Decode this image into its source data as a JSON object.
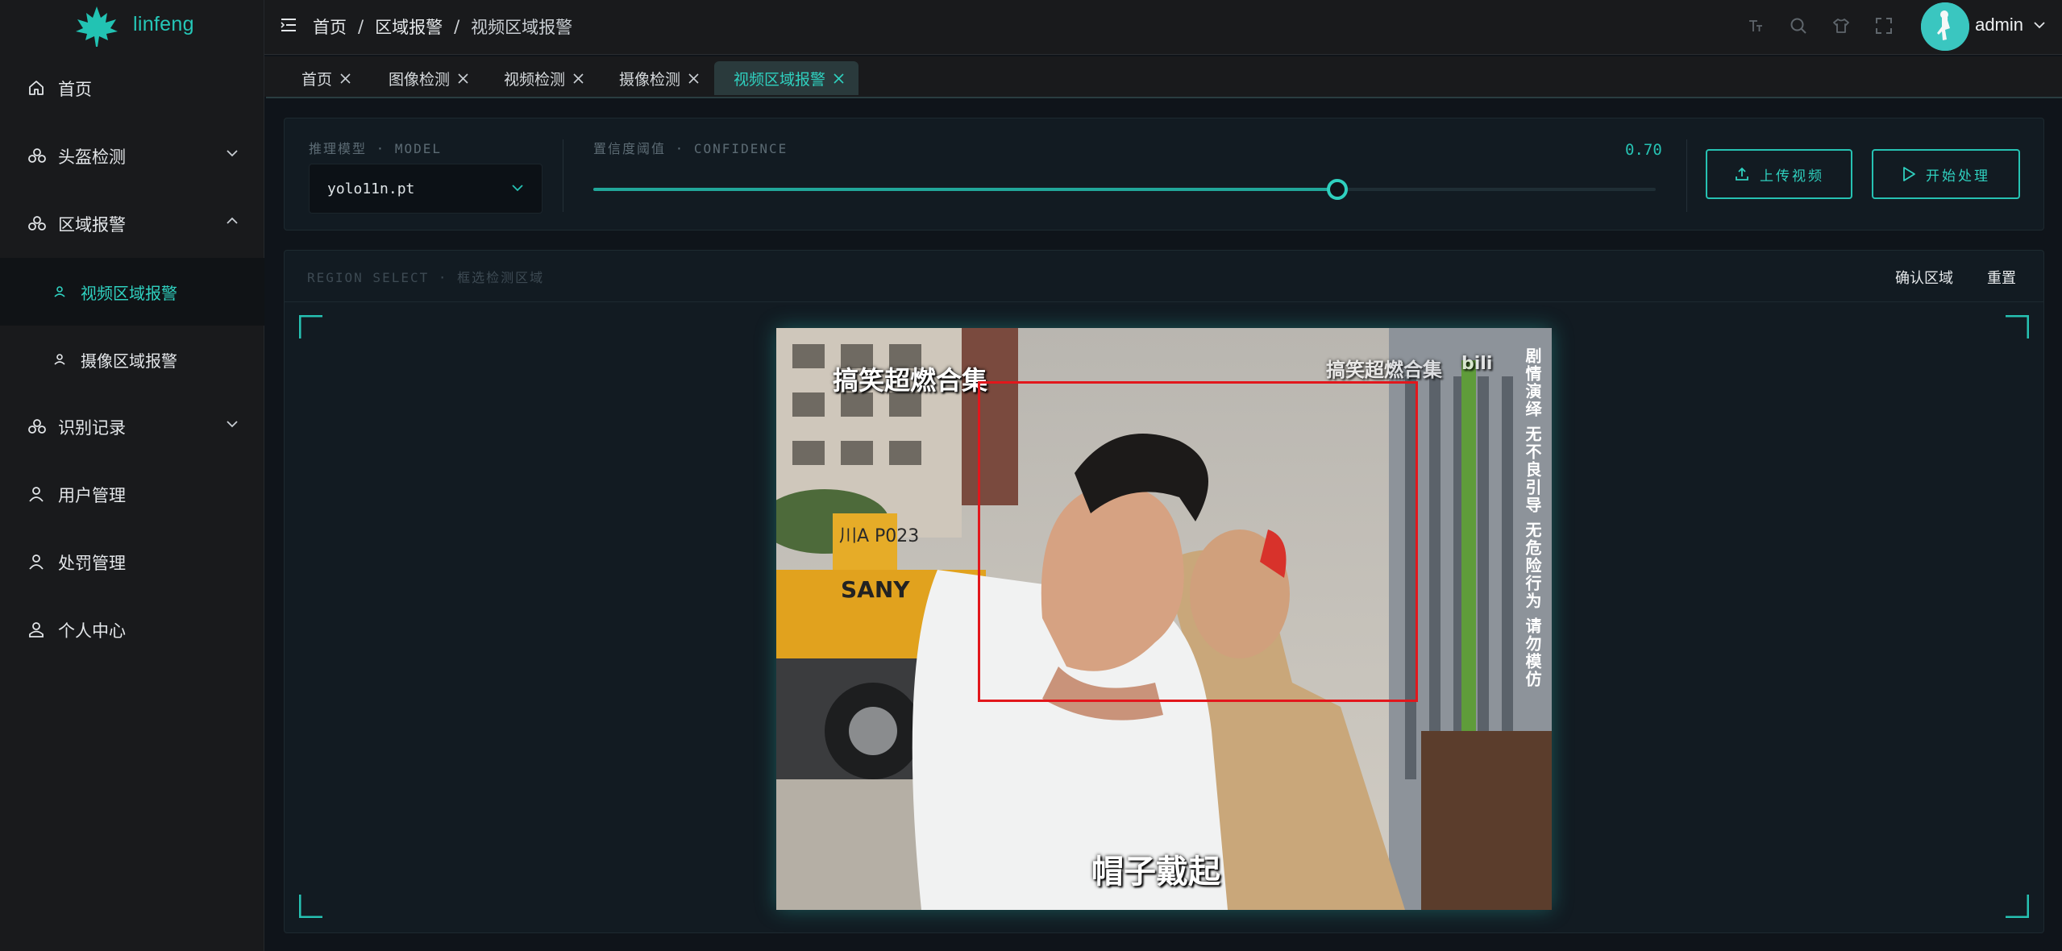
{
  "logo": {
    "text": "linfeng"
  },
  "sidebar": {
    "items": [
      {
        "label": "首页",
        "icon": "home-icon"
      },
      {
        "label": "头盔检测",
        "icon": "helmet-icon",
        "expandable": true,
        "expanded": false
      },
      {
        "label": "区域报警",
        "icon": "helmet-icon",
        "expandable": true,
        "expanded": true
      },
      {
        "label": "视频区域报警",
        "icon": "user-icon",
        "sub": true,
        "active": true
      },
      {
        "label": "摄像区域报警",
        "icon": "user-icon",
        "sub": true
      },
      {
        "label": "识别记录",
        "icon": "helmet-icon",
        "expandable": true,
        "expanded": false
      },
      {
        "label": "用户管理",
        "icon": "user-icon"
      },
      {
        "label": "处罚管理",
        "icon": "user-icon"
      },
      {
        "label": "个人中心",
        "icon": "person-icon"
      }
    ]
  },
  "header": {
    "breadcrumb": [
      "首页",
      "区域报警",
      "视频区域报警"
    ],
    "user": "admin"
  },
  "tabs": [
    {
      "label": "首页"
    },
    {
      "label": "图像检测"
    },
    {
      "label": "视频检测"
    },
    {
      "label": "摄像检测"
    },
    {
      "label": "视频区域报警",
      "active": true
    }
  ],
  "controls": {
    "model_label": "推理模型 · MODEL",
    "model_value": "yolo11n.pt",
    "confidence_label": "置信度阈值 · CONFIDENCE",
    "confidence_value": "0.70",
    "confidence": 0.7,
    "upload_label": "上传视频",
    "start_label": "开始处理"
  },
  "region": {
    "label": "REGION SELECT · 框选检测区域",
    "confirm_label": "确认区域",
    "reset_label": "重置"
  },
  "video": {
    "caption_top_left": "搞笑超燃合集",
    "caption_top_right": "搞笑超燃合集",
    "watermark": "bili",
    "side_text": "剧情演绎 无不良引导 无危险行为 请勿模仿",
    "subtitle": "帽子戴起",
    "sign_text": "SANY",
    "plate_text": "川A P023"
  },
  "colors": {
    "accent": "#2fd0bf",
    "selection": "#e2171c",
    "background": "#0f141a",
    "sidebar": "#191a1c"
  }
}
